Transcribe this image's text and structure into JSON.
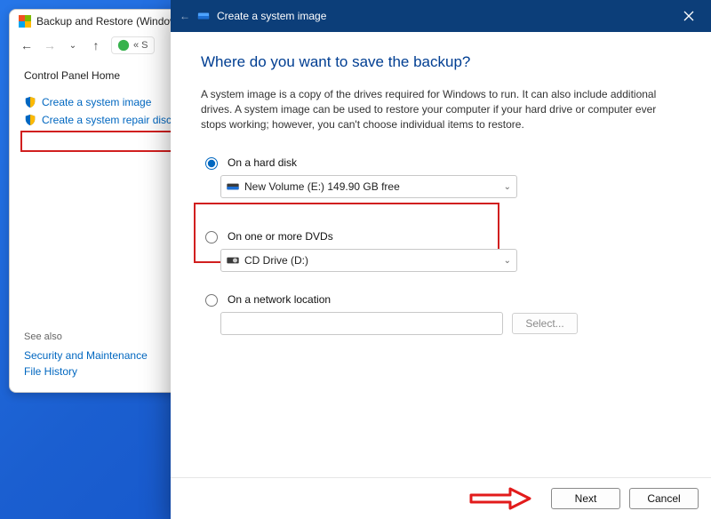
{
  "control_panel": {
    "window_title": "Backup and Restore (Window",
    "address_prev": "« S",
    "home_label": "Control Panel Home",
    "links": [
      {
        "label": "Create a system image"
      },
      {
        "label": "Create a system repair disc"
      }
    ],
    "see_also_header": "See also",
    "see_also": [
      {
        "label": "Security and Maintenance"
      },
      {
        "label": "File History"
      }
    ]
  },
  "dialog": {
    "title": "Create a system image",
    "heading": "Where do you want to save the backup?",
    "description": "A system image is a copy of the drives required for Windows to run. It can also include additional drives. A system image can be used to restore your computer if your hard drive or computer ever stops working; however, you can't choose individual items to restore.",
    "options": {
      "hard_disk": {
        "label": "On a hard disk",
        "selected_drive": "New Volume (E:)  149.90 GB free"
      },
      "dvd": {
        "label": "On one or more DVDs",
        "selected_drive": "CD Drive (D:)"
      },
      "network": {
        "label": "On a network location",
        "select_button": "Select...",
        "path": ""
      }
    },
    "buttons": {
      "next": "Next",
      "cancel": "Cancel"
    }
  }
}
